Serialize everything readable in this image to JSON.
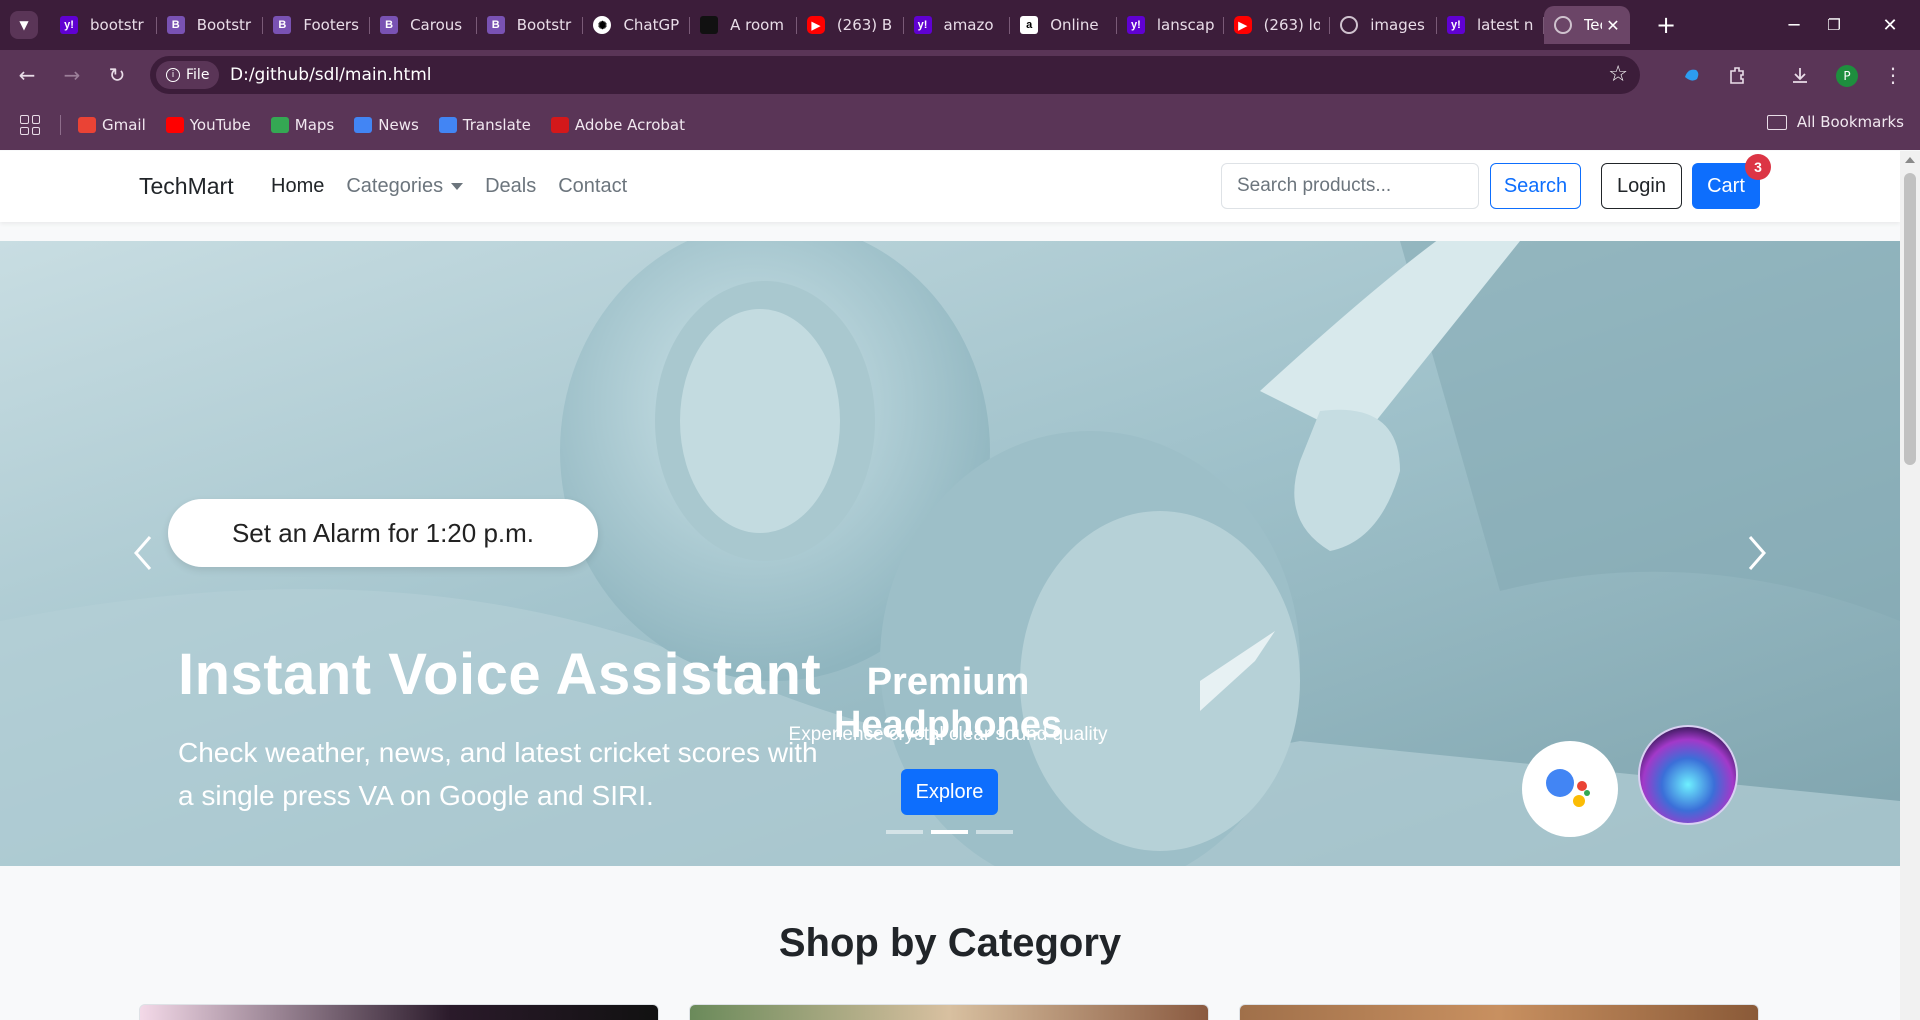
{
  "browser": {
    "tabs": [
      {
        "title": "bootstr",
        "favicon": "yahoo-icon"
      },
      {
        "title": "Bootstr",
        "favicon": "bootstrap-icon"
      },
      {
        "title": "Footers",
        "favicon": "bootstrap-icon"
      },
      {
        "title": "Carous",
        "favicon": "bootstrap-icon"
      },
      {
        "title": "Bootstr",
        "favicon": "bootstrap-icon"
      },
      {
        "title": "ChatGP",
        "favicon": "chatgpt-icon"
      },
      {
        "title": "A room",
        "favicon": "room-icon"
      },
      {
        "title": "(263) B",
        "favicon": "youtube-icon"
      },
      {
        "title": "amazo",
        "favicon": "yahoo-icon"
      },
      {
        "title": "Online",
        "favicon": "amazon-icon"
      },
      {
        "title": "lanscap",
        "favicon": "yahoo-icon"
      },
      {
        "title": "(263) lo",
        "favicon": "youtube-icon"
      },
      {
        "title": "images",
        "favicon": "globe-icon"
      },
      {
        "title": "latest n",
        "favicon": "yahoo-icon"
      },
      {
        "title": "Tec",
        "favicon": "globe-icon",
        "active": true
      }
    ],
    "site_chip": "File",
    "url": "D:/github/sdl/main.html",
    "profile_initial": "P",
    "bookmarks": [
      {
        "label": "Gmail",
        "color": "#ea4335"
      },
      {
        "label": "YouTube",
        "color": "#ff0000"
      },
      {
        "label": "Maps",
        "color": "#34a853"
      },
      {
        "label": "News",
        "color": "#4285f4"
      },
      {
        "label": "Translate",
        "color": "#4285f4"
      },
      {
        "label": "Adobe Acrobat",
        "color": "#d4181a"
      }
    ],
    "all_bookmarks": "All Bookmarks"
  },
  "navbar": {
    "brand": "TechMart",
    "links": [
      "Home",
      "Categories",
      "Deals",
      "Contact"
    ],
    "search_placeholder": "Search products...",
    "search_button": "Search",
    "login_button": "Login",
    "cart_button": "Cart",
    "cart_count": "3"
  },
  "hero": {
    "bubble_text": "Set an Alarm for 1:20 p.m.",
    "ad_title": "Instant Voice Assistant",
    "ad_subtitle": "Check weather, news, and latest cricket scores with a single press VA on Google and SIRI.",
    "caption_title": "Premium Headphones",
    "caption_text": "Experience crystal clear sound quality",
    "cta": "Explore",
    "active_slide": 2,
    "slide_count": 3
  },
  "section": {
    "title": "Shop by Category"
  },
  "colors": {
    "primary": "#0d6efd",
    "danger": "#dc3545",
    "chrome_dark": "#3c1d3a",
    "chrome": "#5a3557"
  }
}
